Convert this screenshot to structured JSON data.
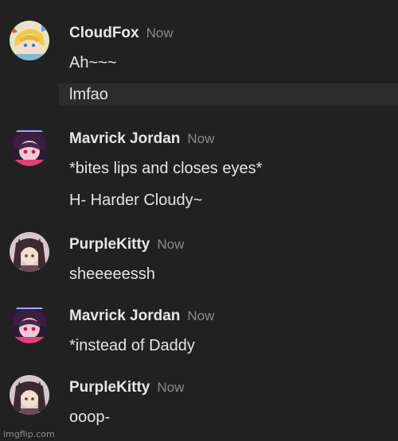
{
  "colors": {
    "background": "#212121",
    "username": "#e6e6e6",
    "timestamp": "#8a8a8a",
    "message": "#e4e4e4",
    "hover_row": "#2c2c2c"
  },
  "groups": [
    {
      "username": "CloudFox",
      "timestamp": "Now",
      "avatar_icon": "anime-character-avatar-icon",
      "messages": [
        "Ah~~~",
        "lmfao"
      ]
    },
    {
      "username": "Mavrick Jordan",
      "timestamp": "Now",
      "avatar_icon": "anime-character-avatar-icon",
      "messages": [
        "*bites lips and closes eyes*",
        "H- Harder Cloudy~"
      ]
    },
    {
      "username": "PurpleKitty",
      "timestamp": "Now",
      "avatar_icon": "anime-character-avatar-icon",
      "messages": [
        "sheeeeessh"
      ]
    },
    {
      "username": "Mavrick Jordan",
      "timestamp": "Now",
      "avatar_icon": "anime-character-avatar-icon",
      "messages": [
        "*instead of Daddy"
      ]
    },
    {
      "username": "PurpleKitty",
      "timestamp": "Now",
      "avatar_icon": "anime-character-avatar-icon",
      "messages": [
        "ooop-"
      ]
    }
  ],
  "watermark": "imgflip.com"
}
